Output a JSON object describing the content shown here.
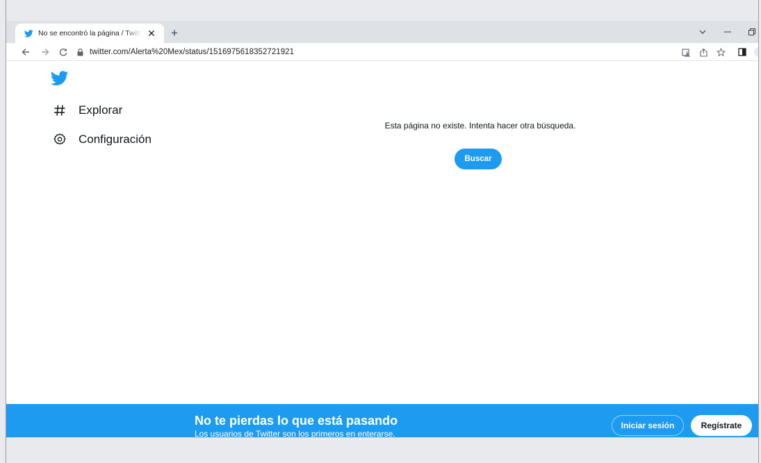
{
  "browser": {
    "tab": {
      "title": "No se encontró la página / Twitter",
      "close_glyph": "✕"
    },
    "new_tab_glyph": "+",
    "url": "twitter.com/Alerta%20Mex/status/1516975618352721921",
    "icons": [
      "back-icon",
      "forward-icon",
      "reload-icon",
      "lock-icon",
      "install-app-icon",
      "share-icon",
      "bookmark-star-icon",
      "side-panel-icon"
    ]
  },
  "sidebar": {
    "items": [
      {
        "label": "Explorar",
        "icon": "hashtag-icon"
      },
      {
        "label": "Configuración",
        "icon": "gear-icon"
      }
    ]
  },
  "main": {
    "message": "Esta página no existe. Intenta hacer otra búsqueda.",
    "search_button": "Buscar"
  },
  "banner": {
    "title": "No te pierdas lo que está pasando",
    "subtitle": "Los usuarios de Twitter son los primeros en enterarse.",
    "login_button": "Iniciar sesión",
    "signup_button": "Regístrate"
  },
  "colors": {
    "twitter_blue": "#1d9bf0",
    "tabstrip": "#dee1e6",
    "text": "#0f1419"
  }
}
